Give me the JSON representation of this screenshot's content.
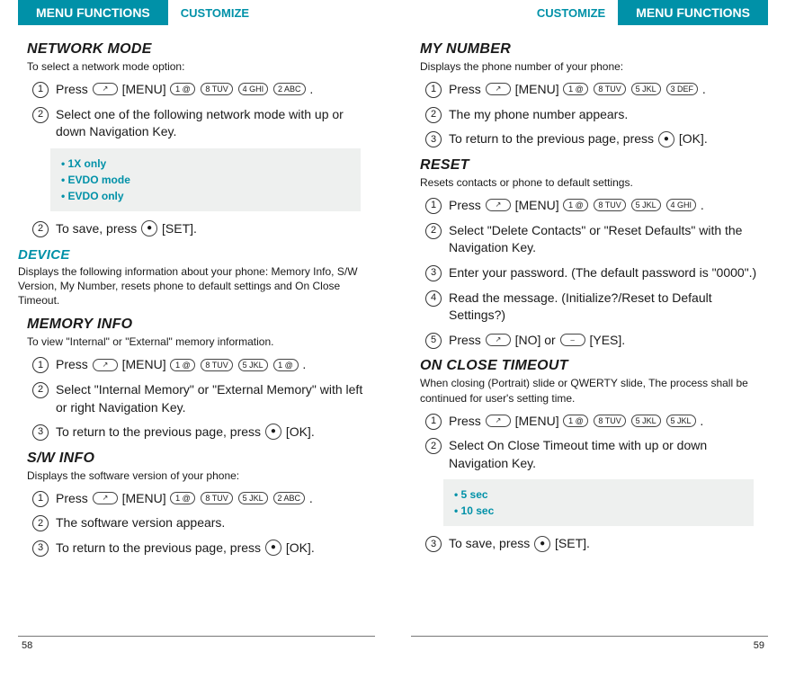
{
  "header": {
    "menu_functions": "MENU FUNCTIONS",
    "customize": "CUSTOMIZE"
  },
  "left": {
    "network_mode": {
      "title": "NETWORK MODE",
      "subtitle": "To select a network mode option:",
      "s1": "Press",
      "s1_menu": "[MENU]",
      "s1_tail": ".",
      "s2": "Select one of the following network mode with up or down Navigation Key.",
      "opts": [
        "1X only",
        "EVDO mode",
        "EVDO only"
      ],
      "s3a": "To save, press ",
      "s3b": " [SET]."
    },
    "device": {
      "title": "DEVICE",
      "subtitle": "Displays the following information about your phone: Memory Info, S/W Version, My Number, resets phone to default settings and On Close Timeout."
    },
    "memory": {
      "title": "MEMORY INFO",
      "subtitle": "To view \"Internal\" or \"External\" memory information.",
      "s1": "Press",
      "s1_menu": "[MENU]",
      "s1_tail": ".",
      "s2": "Select \"Internal Memory\" or \"External Memory\" with left or right Navigation Key.",
      "s3a": "To return to the previous page, press ",
      "s3b": " [OK]."
    },
    "sw": {
      "title": "S/W INFO",
      "subtitle": "Displays the software version of your phone:",
      "s1": "Press",
      "s1_menu": "[MENU]",
      "s1_tail": ".",
      "s2": "The software version appears.",
      "s3a": "To return to the previous page, press ",
      "s3b": " [OK]."
    },
    "page": "58"
  },
  "right": {
    "mynumber": {
      "title": "MY NUMBER",
      "subtitle": "Displays the phone number of your phone:",
      "s1": "Press",
      "s1_menu": "[MENU]",
      "s1_tail": ".",
      "s2": "The my phone number appears.",
      "s3a": "To return to the previous page, press ",
      "s3b": " [OK]."
    },
    "reset": {
      "title": "RESET",
      "subtitle": "Resets contacts or phone to default settings.",
      "s1": "Press",
      "s1_menu": "[MENU]",
      "s1_tail": ".",
      "s2": "Select \"Delete Contacts\" or \"Reset Defaults\" with the Navigation Key.",
      "s3": "Enter your password. (The default password is \"0000\".)",
      "s4": "Read the message. (Initialize?/Reset to Default Settings?)",
      "s5a": "Press ",
      "s5b": " [NO] or ",
      "s5c": " [YES]."
    },
    "onclose": {
      "title": "ON CLOSE TIMEOUT",
      "subtitle": "When closing (Portrait) slide or QWERTY slide, The process shall be continued for user's setting time.",
      "s1": "Press",
      "s1_menu": "[MENU]",
      "s1_tail": ".",
      "s2": "Select On Close Timeout time with up or down Navigation Key.",
      "opts": [
        "5 sec",
        "10 sec"
      ],
      "s3a": "To save, press ",
      "s3b": " [SET]."
    },
    "page": "59"
  },
  "keys": {
    "send": "↗",
    "k1": "1 @",
    "k2": "2 ABC",
    "k3": "3 DEF",
    "k4": "4 GHI",
    "k5": "5 JKL",
    "k8": "8 TUV",
    "ok": "●",
    "softright": "⎯"
  }
}
